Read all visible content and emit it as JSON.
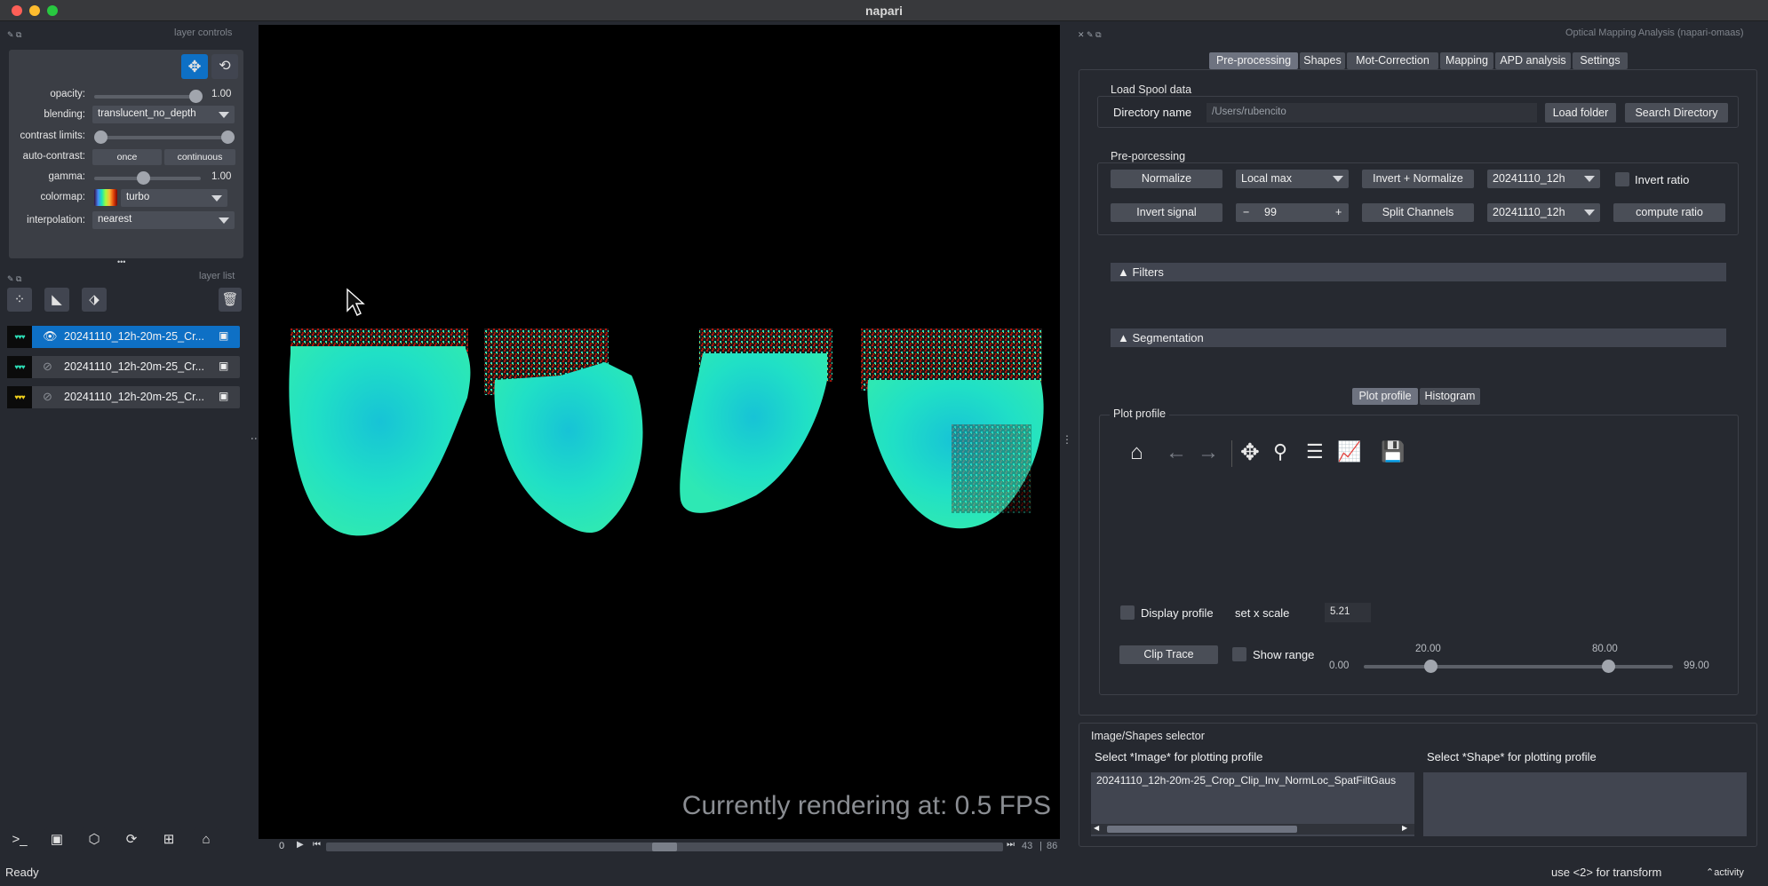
{
  "window": {
    "title": "napari"
  },
  "layer_controls": {
    "header": "layer controls",
    "opacity_label": "opacity:",
    "opacity_value": "1.00",
    "opacity_level": 1.0,
    "blending_label": "blending:",
    "blending_value": "translucent_no_depth",
    "contrast_label": "contrast limits:",
    "auto_contrast_label": "auto-contrast:",
    "auto_once": "once",
    "auto_continuous": "continuous",
    "gamma_label": "gamma:",
    "gamma_value": "1.00",
    "colormap_label": "colormap:",
    "colormap_value": "turbo",
    "interpolation_label": "interpolation:",
    "interpolation_value": "nearest",
    "more_dots": "•••"
  },
  "layer_list": {
    "header": "layer list",
    "layers": [
      {
        "name": "20241110_12h-20m-25_Cr...",
        "selected": true,
        "visible": true
      },
      {
        "name": "20241110_12h-20m-25_Cr...",
        "selected": false,
        "visible": false
      },
      {
        "name": "20241110_12h-20m-25_Cr...",
        "selected": false,
        "visible": false
      }
    ]
  },
  "viewer": {
    "fps_text": "Currently rendering at: 0.5 FPS",
    "slider_start": "0",
    "slider_current": "43",
    "slider_end": "86",
    "slider_position": 0.5
  },
  "plugin": {
    "header": "Optical Mapping Analysis (napari-omaas)",
    "tabs": [
      "Pre-processing",
      "Shapes",
      "Mot-Correction",
      "Mapping",
      "APD analysis",
      "Settings"
    ],
    "load_spool": {
      "title": "Load Spool data",
      "dir_label": "Directory name",
      "dir_value": "/Users/rubencito",
      "load_button": "Load folder",
      "search_button": "Search Directory"
    },
    "preprocessing": {
      "title": "Pre-porcessing",
      "normalize": "Normalize",
      "local_max": "Local max",
      "invert_normalize": "Invert + Normalize",
      "layer_combo_1": "20241110_12h",
      "invert_ratio": "Invert ratio",
      "invert_signal": "Invert signal",
      "spin_minus": "−",
      "spin_value": "99",
      "spin_plus": "+",
      "split_channels": "Split Channels",
      "layer_combo_2": "20241110_12h",
      "compute_ratio": "compute ratio"
    },
    "filters": "Filters",
    "segmentation": "Segmentation",
    "subtabs": [
      "Plot profile",
      "Histogram"
    ],
    "plot_profile": {
      "title": "Plot profile",
      "toolbar": [
        "home-icon",
        "back-icon",
        "forward-icon",
        "pan-icon",
        "zoom-icon",
        "configure-icon",
        "edit-axis-icon",
        "save-icon"
      ],
      "display_profile": "Display profile",
      "set_x_scale": "set x scale",
      "x_scale_value": "5.21",
      "clip_trace": "Clip Trace",
      "show_range": "Show range",
      "range_min": "0.00",
      "range_low": "20.00",
      "range_high": "80.00",
      "range_max": "99.00"
    },
    "selector": {
      "title": "Image/Shapes selector",
      "image_label": "Select *Image* for plotting profile",
      "shape_label": "Select *Shape* for plotting profile",
      "image_item": "20241110_12h-20m-25_Crop_Clip_Inv_NormLoc_SpatFiltGaus"
    }
  },
  "status": {
    "left": "Ready",
    "right": "use <2> for transform",
    "activity": "activity"
  },
  "colors": {
    "accent": "#0e70c5",
    "bg": "#262930",
    "control": "#4a4e57"
  }
}
